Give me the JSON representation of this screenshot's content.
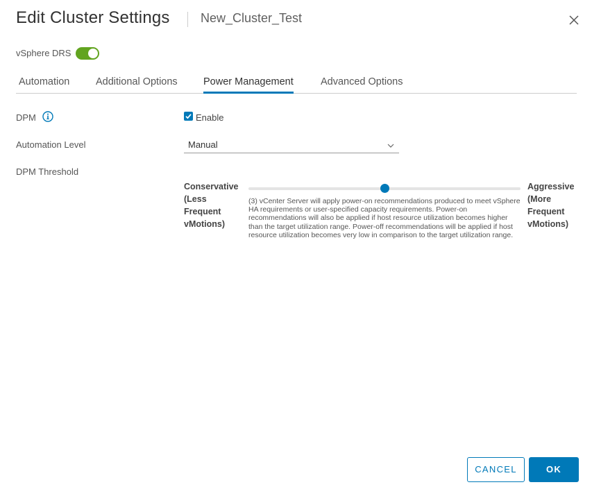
{
  "header": {
    "title": "Edit Cluster Settings",
    "cluster_name": "New_Cluster_Test",
    "close_icon": "close-icon"
  },
  "drs": {
    "label": "vSphere DRS",
    "enabled": true,
    "toggle_color": "#62a420"
  },
  "tabs": [
    {
      "label": "Automation",
      "active": false
    },
    {
      "label": "Additional Options",
      "active": false
    },
    {
      "label": "Power Management",
      "active": true
    },
    {
      "label": "Advanced Options",
      "active": false
    }
  ],
  "form": {
    "dpm": {
      "label": "DPM",
      "info_icon": "info-icon",
      "enable_label": "Enable",
      "enabled": true
    },
    "automation_level": {
      "label": "Automation Level",
      "value": "Manual"
    },
    "threshold": {
      "label": "DPM Threshold",
      "left_label": [
        "Conservative",
        "(Less",
        "Frequent",
        "vMotions)"
      ],
      "right_label": [
        "Aggressive",
        "(More",
        "Frequent",
        "vMotions)"
      ],
      "level": 3,
      "levels": 5,
      "description": "(3) vCenter Server will apply power-on recommendations produced to meet vSphere HA requirements or user-specified capacity requirements. Power-on recommendations will also be applied if host resource utilization becomes higher than the target utilization range. Power-off recommendations will be applied if host resource utilization becomes very low in comparison to the target utilization range."
    }
  },
  "footer": {
    "cancel_label": "CANCEL",
    "ok_label": "OK"
  },
  "colors": {
    "accent": "#0079b8",
    "toggle_on": "#62a420"
  }
}
